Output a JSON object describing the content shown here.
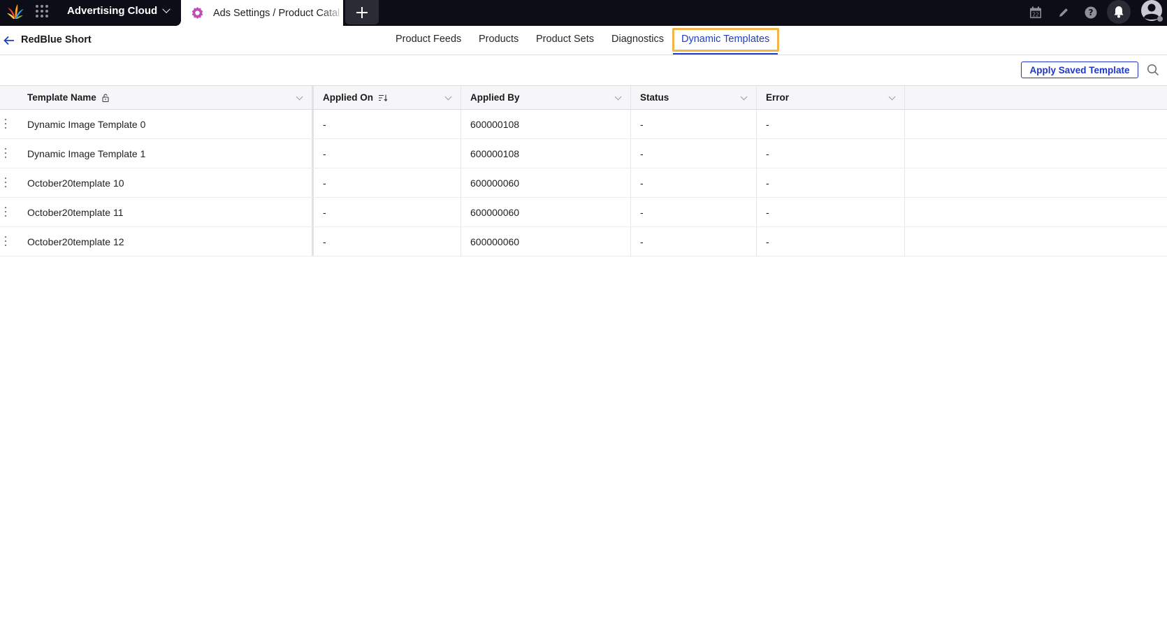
{
  "topbar": {
    "product_name": "Advertising Cloud",
    "active_tab_title": "Ads Settings / Product Catalog",
    "icons": [
      "logo-icon",
      "apps-grid-icon",
      "calendar-icon",
      "pencil-icon",
      "help-icon",
      "bell-icon",
      "user-avatar-icon"
    ],
    "calendar_day": "22",
    "tab_icon_color": "#c04fb5"
  },
  "subheader": {
    "back_icon": "arrow-left-icon",
    "title": "RedBlue Short",
    "nav": [
      {
        "label": "Product Feeds",
        "active": false
      },
      {
        "label": "Products",
        "active": false
      },
      {
        "label": "Product Sets",
        "active": false
      },
      {
        "label": "Diagnostics",
        "active": false
      },
      {
        "label": "Dynamic Templates",
        "active": true
      }
    ],
    "accent_color": "#1f3fbf",
    "highlight_color": "#f2b54a"
  },
  "toolbar": {
    "apply_label": "Apply Saved Template",
    "search_icon": "search-icon"
  },
  "table": {
    "columns": [
      {
        "label": "Template Name",
        "icon": "lock-icon"
      },
      {
        "label": "Applied On",
        "icon": "sort-icon"
      },
      {
        "label": "Applied By"
      },
      {
        "label": "Status"
      },
      {
        "label": "Error"
      }
    ],
    "rows": [
      {
        "name": "Dynamic Image Template 0",
        "applied_on": "-",
        "applied_by": "600000108",
        "status": "-",
        "error": "-"
      },
      {
        "name": "Dynamic Image Template 1",
        "applied_on": "-",
        "applied_by": "600000108",
        "status": "-",
        "error": "-"
      },
      {
        "name": "October20template 10",
        "applied_on": "-",
        "applied_by": "600000060",
        "status": "-",
        "error": "-"
      },
      {
        "name": "October20template 11",
        "applied_on": "-",
        "applied_by": "600000060",
        "status": "-",
        "error": "-"
      },
      {
        "name": "October20template 12",
        "applied_on": "-",
        "applied_by": "600000060",
        "status": "-",
        "error": "-"
      }
    ]
  }
}
